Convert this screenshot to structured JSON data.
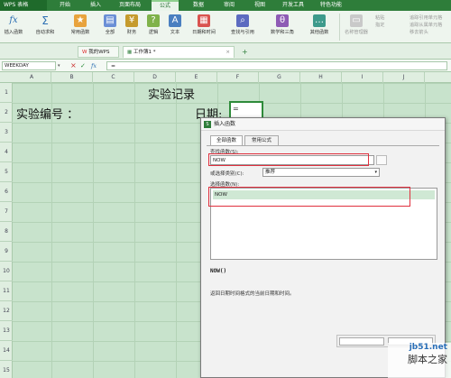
{
  "app": {
    "title": "WPS 表格"
  },
  "menu": {
    "tabs": [
      "开始",
      "插入",
      "页面布局",
      "公式",
      "数据",
      "审阅",
      "视图",
      "开发工具",
      "特色功能"
    ],
    "active": "公式"
  },
  "ribbon": {
    "buttons": [
      "插入函数",
      "自动求和",
      "常用函数",
      "全部",
      "财务",
      "逻辑",
      "文本",
      "日期和时间",
      "查找与引用",
      "数学和三角",
      "其他函数"
    ],
    "right_small": [
      "名称管理器",
      "粘贴",
      "指定",
      "追踪引用单元格",
      "追踪从属单元格",
      "移去箭头",
      "公式求值",
      "错误检查"
    ]
  },
  "doc_tabs": {
    "home": "我的WPS",
    "sheet": "工作簿1 *",
    "add": "+"
  },
  "formula_bar": {
    "name_box": "WEEKDAY",
    "fx": "fx",
    "content": "="
  },
  "sheet": {
    "columns": [
      "A",
      "B",
      "C",
      "D",
      "E",
      "F",
      "G",
      "H",
      "I",
      "J"
    ],
    "rows": [
      "1",
      "2",
      "3",
      "4",
      "5",
      "6",
      "7",
      "8",
      "9",
      "10",
      "11",
      "12",
      "13",
      "14",
      "15"
    ],
    "title_cell": "实验记录",
    "label_cell": "实验编号 ：",
    "date_label": "日期:",
    "active_cell_value": "="
  },
  "dialog": {
    "title": "插入函数",
    "tabs": [
      "全部函数",
      "常用公式"
    ],
    "search_label": "查找函数(S):",
    "search_value": "NOW",
    "category_label": "或选择类别(C):",
    "category_value": "推荐",
    "select_label": "选择函数(N):",
    "functions": [
      "NOW"
    ],
    "signature": "NOW()",
    "description": "返回日期时间格式的当前日期和时间。"
  },
  "watermark": {
    "site": "jb51.net",
    "name": "脚本之家"
  }
}
